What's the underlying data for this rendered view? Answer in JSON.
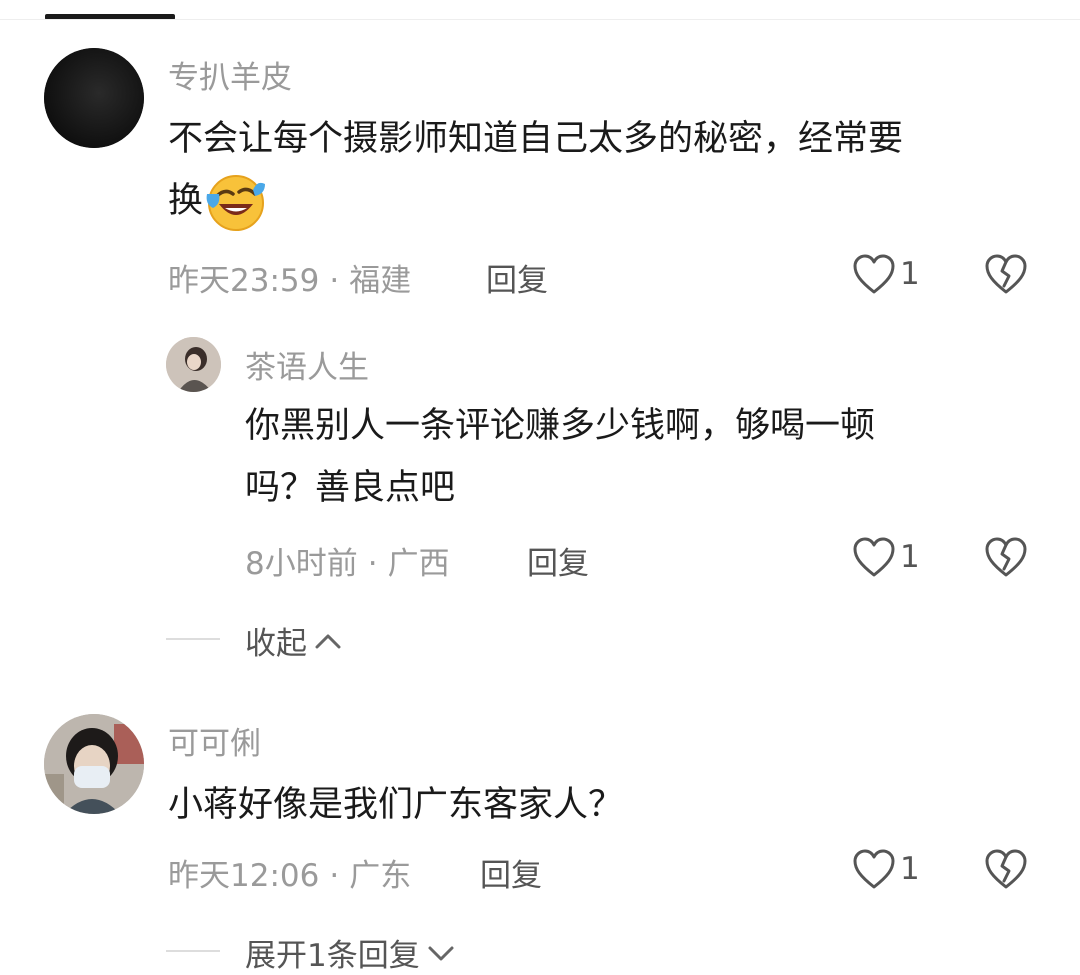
{
  "comments": [
    {
      "author": "专扒羊皮",
      "text_line1": "不会让每个摄影师知道自己太多的秘密，经常要",
      "text_line2": "换",
      "emoji": "crying-laughing-emoji",
      "time": "昨天23:59",
      "location": "福建",
      "reply_label": "回复",
      "likes": "1",
      "replies": [
        {
          "author": "茶语人生",
          "text_line1": "你黑别人一条评论赚多少钱啊，够喝一顿",
          "text_line2": "吗？善良点吧",
          "time": "8小时前",
          "location": "广西",
          "reply_label": "回复",
          "likes": "1"
        }
      ],
      "collapse_label": "收起"
    },
    {
      "author": "可可俐",
      "text_line1": "小蒋好像是我们广东客家人？",
      "time": "昨天12:06",
      "location": "广东",
      "reply_label": "回复",
      "likes": "1",
      "expand_label": "展开1条回复"
    }
  ],
  "separator": "·",
  "icons": {
    "like": "heart-outline-icon",
    "dislike": "broken-heart-icon",
    "collapse": "chevron-up-icon",
    "expand": "chevron-down-icon"
  },
  "colors": {
    "text": "#1a1a1a",
    "secondary": "#9a9a9a",
    "action": "#555555"
  }
}
